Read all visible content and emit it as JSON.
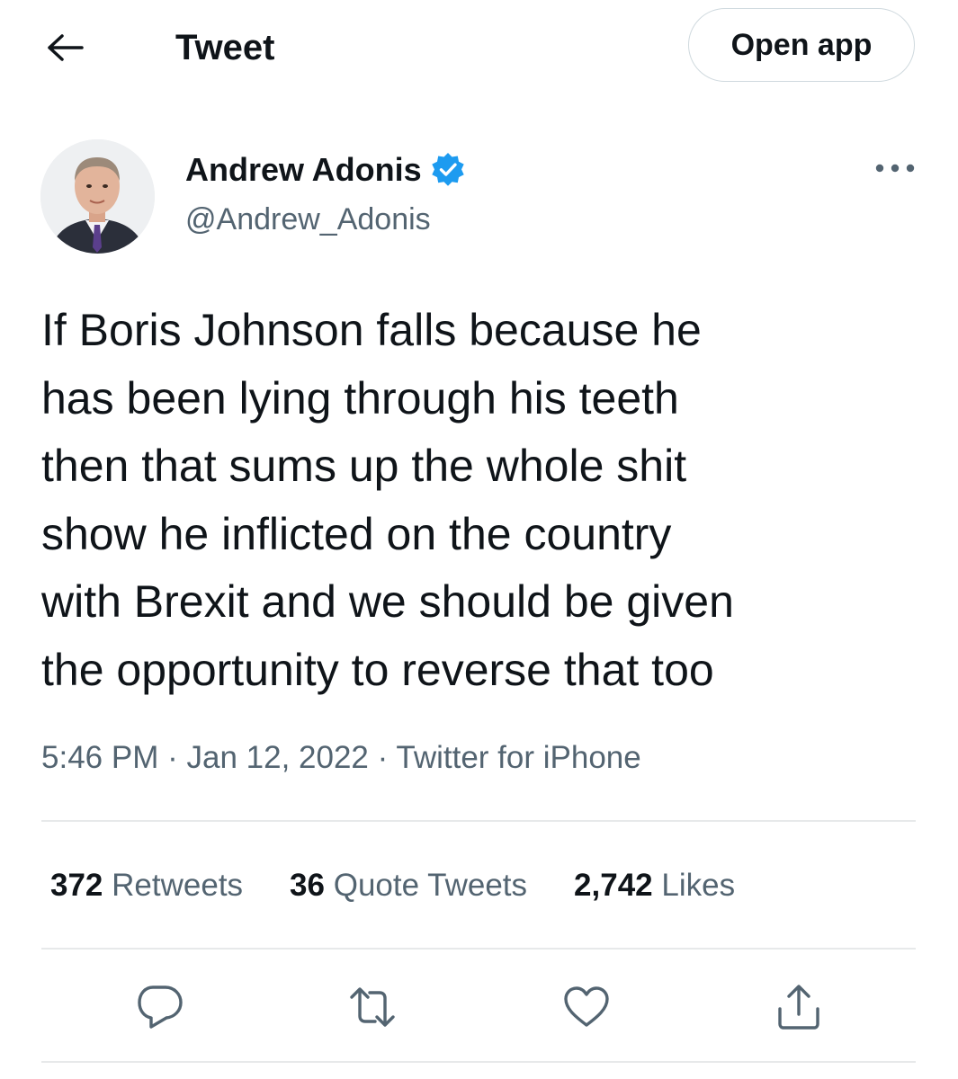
{
  "header": {
    "title": "Tweet",
    "open_app_label": "Open app",
    "back_icon": "arrow-left-icon"
  },
  "author": {
    "display_name": "Andrew Adonis",
    "handle": "@Andrew_Adonis",
    "verified": true,
    "verified_color": "#1d9bf0"
  },
  "tweet": {
    "text": "If Boris Johnson falls because he\nhas been lying through his teeth\nthen that sums up the whole shit\nshow he inflicted on the country\nwith Brexit and we should be given\nthe opportunity to reverse that too",
    "time": "5:46 PM",
    "separator": "·",
    "date": "Jan 12, 2022",
    "source": "Twitter for iPhone"
  },
  "stats": {
    "retweets_count": "372",
    "retweets_label": "Retweets",
    "quotes_count": "36",
    "quotes_label": "Quote Tweets",
    "likes_count": "2,742",
    "likes_label": "Likes"
  },
  "actions": [
    {
      "icon": "reply-icon"
    },
    {
      "icon": "retweet-icon"
    },
    {
      "icon": "like-heart-icon"
    },
    {
      "icon": "share-icon"
    }
  ],
  "colors": {
    "text_primary": "#0f1419",
    "text_secondary": "#536471",
    "divider": "#e7e9ea",
    "accent": "#1d9bf0"
  }
}
